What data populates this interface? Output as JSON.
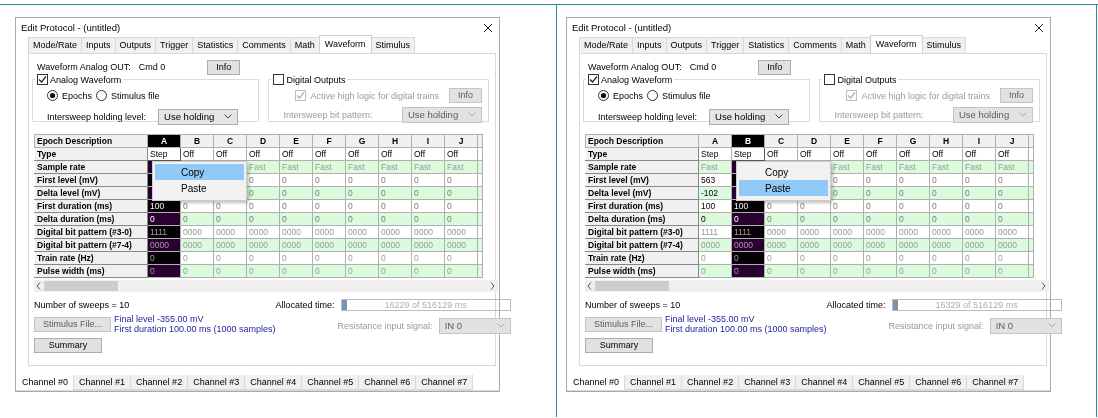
{
  "panels": [
    {
      "title": "Edit Protocol - (untitled)",
      "tabs": [
        {
          "label": "Mode/Rate",
          "selected": false
        },
        {
          "label": "Inputs",
          "selected": false
        },
        {
          "label": "Outputs",
          "selected": false
        },
        {
          "label": "Trigger",
          "selected": false
        },
        {
          "label": "Statistics",
          "selected": false
        },
        {
          "label": "Comments",
          "selected": false
        },
        {
          "label": "Math",
          "selected": false
        },
        {
          "label": "Waveform",
          "selected": true
        },
        {
          "label": "Stimulus",
          "selected": false
        }
      ],
      "output_label": "Waveform Analog OUT:",
      "output_value": "Cmd 0",
      "info_button": "Info",
      "analog": {
        "label": "Analog Waveform",
        "checked": true,
        "sources": [
          {
            "label": "Epochs",
            "selected": true
          },
          {
            "label": "Stimulus file",
            "selected": false
          }
        ],
        "holding_label": "Intersweep holding level:",
        "holding_value": "Use holding"
      },
      "digital": {
        "label": "Digital Outputs",
        "checked": false,
        "active_high": {
          "label": "Active high logic for digital trains",
          "checked": true,
          "disabled": true
        },
        "info_button": {
          "label": "Info",
          "disabled": true
        },
        "pattern_label": "Intersweep bit pattern:",
        "pattern_value": "Use holding",
        "disabled": true
      },
      "grid": {
        "header": "Epoch Description",
        "columns": [
          {
            "label": "A",
            "selected": true,
            "active": true
          },
          {
            "label": "B",
            "selected": false,
            "active": false
          },
          {
            "label": "C",
            "selected": false,
            "active": false
          },
          {
            "label": "D",
            "selected": false,
            "active": false
          },
          {
            "label": "E",
            "selected": false,
            "active": false
          },
          {
            "label": "F",
            "selected": false,
            "active": false
          },
          {
            "label": "G",
            "selected": false,
            "active": false
          },
          {
            "label": "H",
            "selected": false,
            "active": false
          },
          {
            "label": "I",
            "selected": false,
            "active": false
          },
          {
            "label": "J",
            "selected": false,
            "active": false
          }
        ],
        "rows": [
          {
            "label": "Type",
            "kind": "type",
            "shaded": false,
            "cells": [
              "Step",
              "Off",
              "Off",
              "Off",
              "Off",
              "Off",
              "Off",
              "Off",
              "Off",
              "Off"
            ]
          },
          {
            "label": "Sample rate",
            "kind": "value",
            "shaded": true,
            "dimmed": true,
            "cells": [
              null,
              null,
              null,
              "Fast",
              "Fast",
              "Fast",
              "Fast",
              "Fast",
              "Fast",
              "Fast"
            ]
          },
          {
            "label": "First level (mV)",
            "kind": "value",
            "shaded": false,
            "dimmed": false,
            "cells": [
              null,
              null,
              null,
              "0",
              "0",
              "0",
              "0",
              "0",
              "0",
              "0"
            ]
          },
          {
            "label": "Delta level (mV)",
            "kind": "value",
            "shaded": true,
            "dimmed": false,
            "cells": [
              null,
              null,
              null,
              "0",
              "0",
              "0",
              "0",
              "0",
              "0",
              "0"
            ]
          },
          {
            "label": "First duration (ms)",
            "kind": "value",
            "shaded": false,
            "dimmed": false,
            "cells": [
              "100",
              "0",
              "0",
              "0",
              "0",
              "0",
              "0",
              "0",
              "0",
              "0"
            ]
          },
          {
            "label": "Delta duration (ms)",
            "kind": "value",
            "shaded": true,
            "dimmed": false,
            "cells": [
              "0",
              "0",
              "0",
              "0",
              "0",
              "0",
              "0",
              "0",
              "0",
              "0"
            ]
          },
          {
            "label": "Digital bit pattern (#3-0)",
            "kind": "value",
            "shaded": false,
            "dimmed": true,
            "cells": [
              "1111",
              "0000",
              "0000",
              "0000",
              "0000",
              "0000",
              "0000",
              "0000",
              "0000",
              "0000"
            ]
          },
          {
            "label": "Digital bit pattern (#7-4)",
            "kind": "value",
            "shaded": true,
            "dimmed": true,
            "cells": [
              "0000",
              "0000",
              "0000",
              "0000",
              "0000",
              "0000",
              "0000",
              "0000",
              "0000",
              "0000"
            ]
          },
          {
            "label": "Train rate (Hz)",
            "kind": "value",
            "shaded": false,
            "dimmed": true,
            "cells": [
              "0",
              "0",
              "0",
              "0",
              "0",
              "0",
              "0",
              "0",
              "0",
              "0"
            ]
          },
          {
            "label": "Pulse width (ms)",
            "kind": "value",
            "shaded": true,
            "dimmed": true,
            "cells": [
              "0",
              "0",
              "0",
              "0",
              "0",
              "0",
              "0",
              "0",
              "0",
              "0"
            ]
          }
        ]
      },
      "context_menu": [
        {
          "label": "Copy",
          "selected": true
        },
        {
          "label": "Paste",
          "selected": false
        }
      ],
      "sweeps": "Number of sweeps = 10",
      "allocated": {
        "label": "Allocated time:",
        "text": "16229 of 516129 ms",
        "level": 0.03
      },
      "stimulus_button": {
        "label": "Stimulus File...",
        "disabled": true
      },
      "info_lines": [
        "Final level -355.00 mV",
        "First duration 100.00 ms (1000 samples)"
      ],
      "resistance": {
        "label": "Resistance input signal:",
        "value": "IN 0",
        "disabled": true
      },
      "summary_button": "Summary",
      "channels": [
        {
          "label": "Channel #0",
          "selected": true
        },
        {
          "label": "Channel #1",
          "selected": false
        },
        {
          "label": "Channel #2",
          "selected": false
        },
        {
          "label": "Channel #3",
          "selected": false
        },
        {
          "label": "Channel #4",
          "selected": false
        },
        {
          "label": "Channel #5",
          "selected": false
        },
        {
          "label": "Channel #6",
          "selected": false
        },
        {
          "label": "Channel #7",
          "selected": false
        }
      ]
    },
    {
      "title": "Edit Protocol - (untitled)",
      "tabs": [
        {
          "label": "Mode/Rate",
          "selected": false
        },
        {
          "label": "Inputs",
          "selected": false
        },
        {
          "label": "Outputs",
          "selected": false
        },
        {
          "label": "Trigger",
          "selected": false
        },
        {
          "label": "Statistics",
          "selected": false
        },
        {
          "label": "Comments",
          "selected": false
        },
        {
          "label": "Math",
          "selected": false
        },
        {
          "label": "Waveform",
          "selected": true
        },
        {
          "label": "Stimulus",
          "selected": false
        }
      ],
      "output_label": "Waveform Analog OUT:",
      "output_value": "Cmd 0",
      "info_button": "Info",
      "analog": {
        "label": "Analog Waveform",
        "checked": true,
        "sources": [
          {
            "label": "Epochs",
            "selected": true
          },
          {
            "label": "Stimulus file",
            "selected": false
          }
        ],
        "holding_label": "Intersweep holding level:",
        "holding_value": "Use holding"
      },
      "digital": {
        "label": "Digital Outputs",
        "checked": false,
        "active_high": {
          "label": "Active high logic for digital trains",
          "checked": true,
          "disabled": true
        },
        "info_button": {
          "label": "Info",
          "disabled": true
        },
        "pattern_label": "Intersweep bit pattern:",
        "pattern_value": "Use holding",
        "disabled": true
      },
      "grid": {
        "header": "Epoch Description",
        "columns": [
          {
            "label": "A",
            "selected": false,
            "active": true
          },
          {
            "label": "B",
            "selected": true,
            "active": true
          },
          {
            "label": "C",
            "selected": false,
            "active": false
          },
          {
            "label": "D",
            "selected": false,
            "active": false
          },
          {
            "label": "E",
            "selected": false,
            "active": false
          },
          {
            "label": "F",
            "selected": false,
            "active": false
          },
          {
            "label": "G",
            "selected": false,
            "active": false
          },
          {
            "label": "H",
            "selected": false,
            "active": false
          },
          {
            "label": "I",
            "selected": false,
            "active": false
          },
          {
            "label": "J",
            "selected": false,
            "active": false
          }
        ],
        "rows": [
          {
            "label": "Type",
            "kind": "type",
            "shaded": false,
            "cells": [
              "Step",
              "Step",
              "Off",
              "Off",
              "Off",
              "Off",
              "Off",
              "Off",
              "Off",
              "Off"
            ]
          },
          {
            "label": "Sample rate",
            "kind": "value",
            "shaded": true,
            "dimmed": true,
            "cells": [
              "Fast",
              null,
              null,
              null,
              "Fast",
              "Fast",
              "Fast",
              "Fast",
              "Fast",
              "Fast"
            ]
          },
          {
            "label": "First level (mV)",
            "kind": "value",
            "shaded": false,
            "dimmed": false,
            "cells": [
              "563",
              null,
              null,
              null,
              "0",
              "0",
              "0",
              "0",
              "0",
              "0"
            ]
          },
          {
            "label": "Delta level (mV)",
            "kind": "value",
            "shaded": true,
            "dimmed": false,
            "cells": [
              "-102",
              null,
              null,
              null,
              "0",
              "0",
              "0",
              "0",
              "0",
              "0"
            ]
          },
          {
            "label": "First duration (ms)",
            "kind": "value",
            "shaded": false,
            "dimmed": false,
            "cells": [
              "100",
              "100",
              "0",
              "0",
              "0",
              "0",
              "0",
              "0",
              "0",
              "0"
            ]
          },
          {
            "label": "Delta duration (ms)",
            "kind": "value",
            "shaded": true,
            "dimmed": false,
            "cells": [
              "0",
              "0",
              "0",
              "0",
              "0",
              "0",
              "0",
              "0",
              "0",
              "0"
            ]
          },
          {
            "label": "Digital bit pattern (#3-0)",
            "kind": "value",
            "shaded": false,
            "dimmed": true,
            "cells": [
              "1111",
              "1111",
              "0000",
              "0000",
              "0000",
              "0000",
              "0000",
              "0000",
              "0000",
              "0000"
            ]
          },
          {
            "label": "Digital bit pattern (#7-4)",
            "kind": "value",
            "shaded": true,
            "dimmed": true,
            "cells": [
              "0000",
              "0000",
              "0000",
              "0000",
              "0000",
              "0000",
              "0000",
              "0000",
              "0000",
              "0000"
            ]
          },
          {
            "label": "Train rate (Hz)",
            "kind": "value",
            "shaded": false,
            "dimmed": true,
            "cells": [
              "0",
              "0",
              "0",
              "0",
              "0",
              "0",
              "0",
              "0",
              "0",
              "0"
            ]
          },
          {
            "label": "Pulse width (ms)",
            "kind": "value",
            "shaded": true,
            "dimmed": true,
            "cells": [
              "0",
              "0",
              "0",
              "0",
              "0",
              "0",
              "0",
              "0",
              "0",
              "0"
            ]
          }
        ]
      },
      "context_menu": [
        {
          "label": "Copy",
          "selected": false
        },
        {
          "label": "Paste",
          "selected": true
        }
      ],
      "sweeps": "Number of sweeps = 10",
      "allocated": {
        "label": "Allocated time:",
        "text": "16329 of 516129 ms",
        "level": 0.03
      },
      "stimulus_button": {
        "label": "Stimulus File...",
        "disabled": true
      },
      "info_lines": [
        "Final level -355.00 mV",
        "First duration 100.00 ms (1000 samples)"
      ],
      "resistance": {
        "label": "Resistance input signal:",
        "value": "IN 0",
        "disabled": true
      },
      "summary_button": "Summary",
      "channels": [
        {
          "label": "Channel #0",
          "selected": true
        },
        {
          "label": "Channel #1",
          "selected": false
        },
        {
          "label": "Channel #2",
          "selected": false
        },
        {
          "label": "Channel #3",
          "selected": false
        },
        {
          "label": "Channel #4",
          "selected": false
        },
        {
          "label": "Channel #5",
          "selected": false
        },
        {
          "label": "Channel #6",
          "selected": false
        },
        {
          "label": "Channel #7",
          "selected": false
        }
      ]
    }
  ]
}
